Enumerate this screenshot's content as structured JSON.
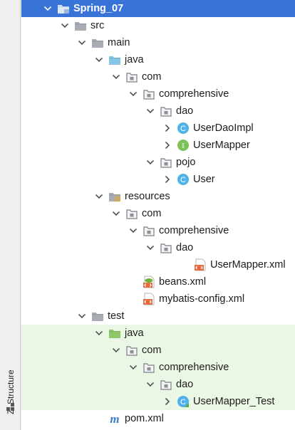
{
  "side_panel": {
    "tab_label": "Z: Structure"
  },
  "tree": [
    {
      "label": "Spring_07",
      "icon": "module-folder-icon",
      "arrow": "down",
      "level": 0,
      "selected": true,
      "test": false
    },
    {
      "label": "src",
      "icon": "folder-icon",
      "arrow": "down",
      "level": 1,
      "selected": false,
      "test": false
    },
    {
      "label": "main",
      "icon": "folder-icon",
      "arrow": "down",
      "level": 2,
      "selected": false,
      "test": false
    },
    {
      "label": "java",
      "icon": "source-folder-icon",
      "arrow": "down",
      "level": 3,
      "selected": false,
      "test": false
    },
    {
      "label": "com",
      "icon": "package-icon",
      "arrow": "down",
      "level": 4,
      "selected": false,
      "test": false
    },
    {
      "label": "comprehensive",
      "icon": "package-icon",
      "arrow": "down",
      "level": 5,
      "selected": false,
      "test": false
    },
    {
      "label": "dao",
      "icon": "package-icon",
      "arrow": "down",
      "level": 6,
      "selected": false,
      "test": false
    },
    {
      "label": "UserDaoImpl",
      "icon": "class-icon",
      "arrow": "right",
      "level": 7,
      "selected": false,
      "test": false
    },
    {
      "label": "UserMapper",
      "icon": "interface-icon",
      "arrow": "right",
      "level": 7,
      "selected": false,
      "test": false
    },
    {
      "label": "pojo",
      "icon": "package-icon",
      "arrow": "down",
      "level": 6,
      "selected": false,
      "test": false
    },
    {
      "label": "User",
      "icon": "class-icon",
      "arrow": "right",
      "level": 7,
      "selected": false,
      "test": false
    },
    {
      "label": "resources",
      "icon": "resources-folder-icon",
      "arrow": "down",
      "level": 3,
      "selected": false,
      "test": false
    },
    {
      "label": "com",
      "icon": "package-icon",
      "arrow": "down",
      "level": 4,
      "selected": false,
      "test": false
    },
    {
      "label": "comprehensive",
      "icon": "package-icon",
      "arrow": "down",
      "level": 5,
      "selected": false,
      "test": false
    },
    {
      "label": "dao",
      "icon": "package-icon",
      "arrow": "down",
      "level": 6,
      "selected": false,
      "test": false
    },
    {
      "label": "UserMapper.xml",
      "icon": "xml-file-icon",
      "arrow": "none",
      "level": 8,
      "selected": false,
      "test": false
    },
    {
      "label": "beans.xml",
      "icon": "spring-xml-icon",
      "arrow": "none",
      "level": 5,
      "selected": false,
      "test": false
    },
    {
      "label": "mybatis-config.xml",
      "icon": "xml-file-icon",
      "arrow": "none",
      "level": 5,
      "selected": false,
      "test": false
    },
    {
      "label": "test",
      "icon": "folder-icon",
      "arrow": "down",
      "level": 2,
      "selected": false,
      "test": false
    },
    {
      "label": "java",
      "icon": "test-source-folder-icon",
      "arrow": "down",
      "level": 3,
      "selected": false,
      "test": true
    },
    {
      "label": "com",
      "icon": "package-icon",
      "arrow": "down",
      "level": 4,
      "selected": false,
      "test": true
    },
    {
      "label": "comprehensive",
      "icon": "package-icon",
      "arrow": "down",
      "level": 5,
      "selected": false,
      "test": true
    },
    {
      "label": "dao",
      "icon": "package-icon",
      "arrow": "down",
      "level": 6,
      "selected": false,
      "test": true
    },
    {
      "label": "UserMapper_Test",
      "icon": "test-class-icon",
      "arrow": "right",
      "level": 7,
      "selected": false,
      "test": true
    },
    {
      "label": "pom.xml",
      "icon": "maven-icon",
      "arrow": "none",
      "level": 3,
      "selected": false,
      "test": false
    }
  ]
}
